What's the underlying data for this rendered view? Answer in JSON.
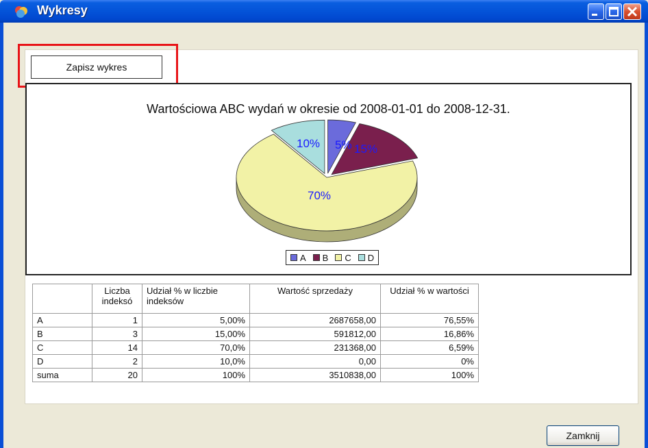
{
  "window": {
    "title": "Wykresy",
    "controls": [
      "minimize-icon",
      "maximize-icon",
      "close-icon"
    ]
  },
  "toolbar": {
    "save_chart_label": "Zapisz wykres",
    "highlight_color": "#e81418"
  },
  "chart_data": {
    "type": "pie",
    "title": "Wartościowa ABC wydań w okresie od 2008-01-01 do 2008-12-31.",
    "slices": [
      {
        "name": "A",
        "value": 5,
        "label": "5%",
        "color": "#6b6bdb"
      },
      {
        "name": "B",
        "value": 15,
        "label": "15%",
        "color": "#7a1f4d"
      },
      {
        "name": "C",
        "value": 70,
        "label": "70%",
        "color": "#f2f2a6"
      },
      {
        "name": "D",
        "value": 10,
        "label": "10%",
        "color": "#a9dede"
      }
    ],
    "legend": [
      "A",
      "B",
      "C",
      "D"
    ],
    "legend_position": "bottom-center",
    "label_color": "#1a1aff"
  },
  "table": {
    "headers": [
      "",
      "Liczba indeksó",
      "Udział % w liczbie indeksów",
      "Wartość sprzedaży",
      "Udział % w wartości"
    ],
    "rows": [
      [
        "A",
        "1",
        "5,00%",
        "2687658,00",
        "76,55%"
      ],
      [
        "B",
        "3",
        "15,00%",
        "591812,00",
        "16,86%"
      ],
      [
        "C",
        "14",
        "70,0%",
        "231368,00",
        "6,59%"
      ],
      [
        "D",
        "2",
        "10,0%",
        "0,00",
        "0%"
      ],
      [
        "suma",
        "20",
        "100%",
        "3510838,00",
        "100%"
      ]
    ]
  },
  "footer": {
    "close_label": "Zamknij"
  }
}
